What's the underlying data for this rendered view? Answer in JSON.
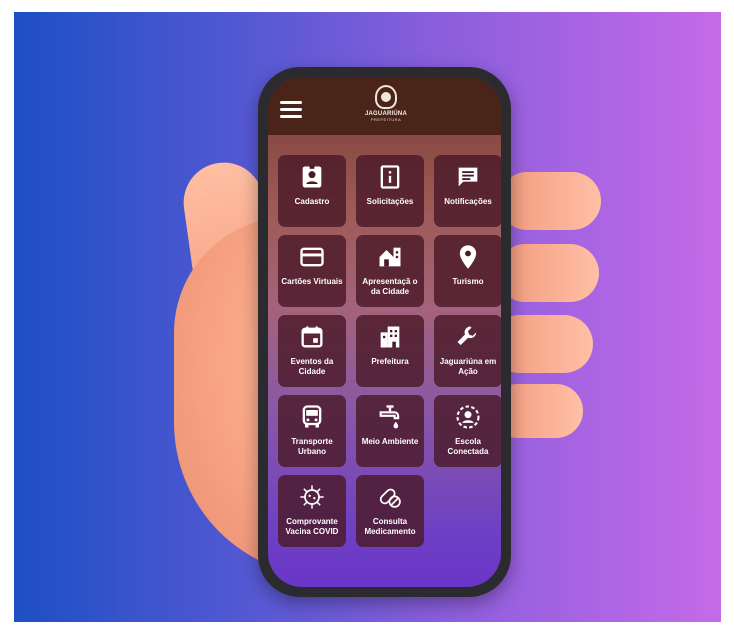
{
  "app": {
    "logo_name": "JAGUARIÚNA",
    "logo_sub": "PREFEITURA"
  },
  "tiles": [
    {
      "label": "Cadastro",
      "icon": "id-badge-icon"
    },
    {
      "label": "Solicitações",
      "icon": "info-icon"
    },
    {
      "label": "Notificações",
      "icon": "message-icon"
    },
    {
      "label": "Cartões Virtuais",
      "icon": "card-icon"
    },
    {
      "label": "Apresentaçã o da Cidade",
      "icon": "city-house-icon"
    },
    {
      "label": "Turismo",
      "icon": "map-pin-icon"
    },
    {
      "label": "Eventos da Cidade",
      "icon": "calendar-icon"
    },
    {
      "label": "Prefeitura",
      "icon": "building-icon"
    },
    {
      "label": "Jaguariúna em Ação",
      "icon": "wrench-icon"
    },
    {
      "label": "Transporte Urbano",
      "icon": "bus-icon"
    },
    {
      "label": "Meio Ambiente",
      "icon": "water-tap-icon"
    },
    {
      "label": "Escola Conectada",
      "icon": "student-icon"
    },
    {
      "label": "Comprovante Vacina COVID",
      "icon": "virus-icon"
    },
    {
      "label": "Consulta Medicamento",
      "icon": "pill-icon"
    }
  ],
  "colors": {
    "background_left": "#1d4fc4",
    "background_right": "#c56ae8",
    "app_bar": "#4a2418",
    "tile": "#4a1a28"
  }
}
